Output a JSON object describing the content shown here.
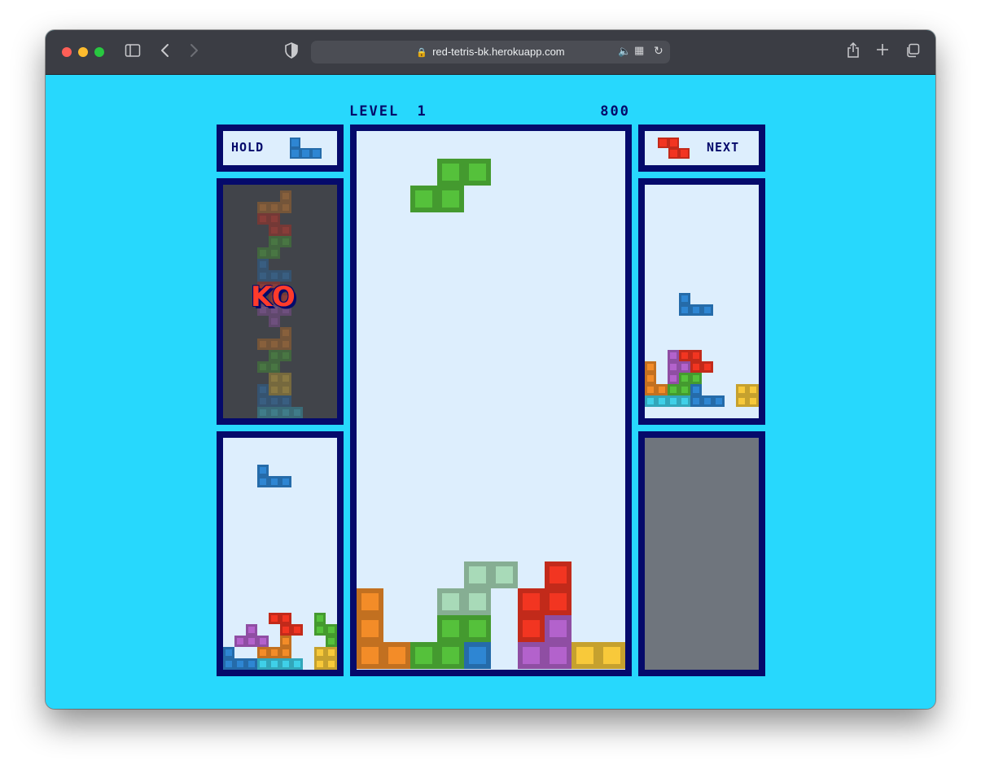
{
  "browser": {
    "url": "red-tetris-bk.herokuapp.com",
    "nav_icons": {
      "sidebar": "sidebar-icon",
      "back": "back-icon",
      "forward": "forward-icon",
      "shield": "shield-icon",
      "share": "share-icon",
      "new_tab": "plus-icon",
      "tabs": "tabs-icon"
    }
  },
  "game": {
    "level_label": "LEVEL",
    "level_value": "1",
    "score": "800",
    "hold_label": "HOLD",
    "next_label": "NEXT",
    "ko_label": "KO",
    "colors": {
      "I": "#3fd0e8",
      "O": "#f8c93a",
      "T": "#b362cc",
      "S": "#55c13b",
      "Z": "#f23521",
      "J": "#2e86d3",
      "L": "#f38c28",
      "G": "#a8dab8",
      "frame": "#050a6b",
      "board_bg": "#ddeefd",
      "page_bg": "#27d8fd"
    },
    "hold_piece": {
      "cells": [
        [
          0,
          0,
          "J"
        ],
        [
          0,
          1,
          "J"
        ],
        [
          1,
          1,
          "J"
        ],
        [
          2,
          1,
          "J"
        ]
      ]
    },
    "next_piece": {
      "cells": [
        [
          0,
          0,
          "Z"
        ],
        [
          1,
          0,
          "Z"
        ],
        [
          1,
          1,
          "Z"
        ],
        [
          2,
          1,
          "Z"
        ]
      ]
    },
    "main_board": {
      "cols": 10,
      "rows": 20,
      "cells": [
        [
          3,
          1,
          "S"
        ],
        [
          4,
          1,
          "S"
        ],
        [
          3,
          2,
          "S"
        ],
        [
          2,
          2,
          "S"
        ],
        [
          4,
          16,
          "G"
        ],
        [
          5,
          16,
          "G"
        ],
        [
          3,
          17,
          "G"
        ],
        [
          4,
          17,
          "G"
        ],
        [
          7,
          16,
          "Z"
        ],
        [
          6,
          17,
          "Z"
        ],
        [
          7,
          17,
          "Z"
        ],
        [
          6,
          18,
          "Z"
        ],
        [
          0,
          17,
          "L"
        ],
        [
          0,
          18,
          "L"
        ],
        [
          0,
          19,
          "L"
        ],
        [
          1,
          19,
          "L"
        ],
        [
          3,
          18,
          "S"
        ],
        [
          4,
          18,
          "S"
        ],
        [
          2,
          19,
          "S"
        ],
        [
          3,
          19,
          "S"
        ],
        [
          4,
          19,
          "J"
        ],
        [
          7,
          18,
          "T"
        ],
        [
          6,
          19,
          "T"
        ],
        [
          7,
          19,
          "T"
        ],
        [
          8,
          19,
          "O"
        ],
        [
          9,
          19,
          "O"
        ]
      ]
    },
    "opponents": [
      {
        "id": "left-top",
        "ko": true,
        "cols": 10,
        "rows": 20,
        "cells": [
          [
            5,
            0,
            "L"
          ],
          [
            3,
            1,
            "L"
          ],
          [
            4,
            1,
            "L"
          ],
          [
            5,
            1,
            "L"
          ],
          [
            3,
            2,
            "Z"
          ],
          [
            4,
            2,
            "Z"
          ],
          [
            4,
            3,
            "Z"
          ],
          [
            5,
            3,
            "Z"
          ],
          [
            4,
            4,
            "S"
          ],
          [
            5,
            4,
            "S"
          ],
          [
            3,
            5,
            "S"
          ],
          [
            4,
            5,
            "S"
          ],
          [
            3,
            6,
            "J"
          ],
          [
            3,
            7,
            "J"
          ],
          [
            4,
            7,
            "J"
          ],
          [
            5,
            7,
            "J"
          ],
          [
            3,
            8,
            "Z"
          ],
          [
            4,
            8,
            "Z"
          ],
          [
            4,
            9,
            "Z"
          ],
          [
            5,
            9,
            "Z"
          ],
          [
            3,
            10,
            "T"
          ],
          [
            4,
            10,
            "T"
          ],
          [
            5,
            10,
            "T"
          ],
          [
            4,
            11,
            "T"
          ],
          [
            5,
            12,
            "L"
          ],
          [
            3,
            13,
            "L"
          ],
          [
            4,
            13,
            "L"
          ],
          [
            5,
            13,
            "L"
          ],
          [
            4,
            14,
            "S"
          ],
          [
            5,
            14,
            "S"
          ],
          [
            3,
            15,
            "S"
          ],
          [
            4,
            15,
            "S"
          ],
          [
            4,
            16,
            "O"
          ],
          [
            5,
            16,
            "O"
          ],
          [
            4,
            17,
            "O"
          ],
          [
            5,
            17,
            "O"
          ],
          [
            3,
            17,
            "J"
          ],
          [
            3,
            18,
            "J"
          ],
          [
            4,
            18,
            "J"
          ],
          [
            5,
            18,
            "J"
          ],
          [
            3,
            19,
            "I"
          ],
          [
            4,
            19,
            "I"
          ],
          [
            5,
            19,
            "I"
          ],
          [
            6,
            19,
            "I"
          ]
        ]
      },
      {
        "id": "left-bottom",
        "ko": false,
        "cols": 10,
        "rows": 20,
        "cells": [
          [
            3,
            2,
            "J"
          ],
          [
            3,
            3,
            "J"
          ],
          [
            4,
            3,
            "J"
          ],
          [
            5,
            3,
            "J"
          ],
          [
            4,
            15,
            "Z"
          ],
          [
            5,
            15,
            "Z"
          ],
          [
            5,
            16,
            "Z"
          ],
          [
            6,
            16,
            "Z"
          ],
          [
            8,
            15,
            "S"
          ],
          [
            8,
            16,
            "S"
          ],
          [
            9,
            16,
            "S"
          ],
          [
            9,
            17,
            "S"
          ],
          [
            2,
            16,
            "T"
          ],
          [
            1,
            17,
            "T"
          ],
          [
            2,
            17,
            "T"
          ],
          [
            3,
            17,
            "T"
          ],
          [
            5,
            17,
            "L"
          ],
          [
            3,
            18,
            "L"
          ],
          [
            4,
            18,
            "L"
          ],
          [
            5,
            18,
            "L"
          ],
          [
            0,
            18,
            "J"
          ],
          [
            0,
            19,
            "J"
          ],
          [
            1,
            19,
            "J"
          ],
          [
            2,
            19,
            "J"
          ],
          [
            3,
            19,
            "I"
          ],
          [
            4,
            19,
            "I"
          ],
          [
            5,
            19,
            "I"
          ],
          [
            6,
            19,
            "I"
          ],
          [
            8,
            18,
            "O"
          ],
          [
            9,
            18,
            "O"
          ],
          [
            8,
            19,
            "O"
          ],
          [
            9,
            19,
            "O"
          ]
        ]
      },
      {
        "id": "right-top",
        "ko": false,
        "cols": 10,
        "rows": 20,
        "cells": [
          [
            3,
            9,
            "J"
          ],
          [
            3,
            10,
            "J"
          ],
          [
            4,
            10,
            "J"
          ],
          [
            5,
            10,
            "J"
          ],
          [
            2,
            14,
            "T"
          ],
          [
            2,
            15,
            "T"
          ],
          [
            3,
            15,
            "T"
          ],
          [
            2,
            16,
            "T"
          ],
          [
            3,
            14,
            "Z"
          ],
          [
            4,
            14,
            "Z"
          ],
          [
            4,
            15,
            "Z"
          ],
          [
            5,
            15,
            "Z"
          ],
          [
            3,
            16,
            "S"
          ],
          [
            4,
            16,
            "S"
          ],
          [
            2,
            17,
            "S"
          ],
          [
            3,
            17,
            "S"
          ],
          [
            0,
            15,
            "L"
          ],
          [
            0,
            16,
            "L"
          ],
          [
            0,
            17,
            "L"
          ],
          [
            1,
            17,
            "L"
          ],
          [
            4,
            17,
            "J"
          ],
          [
            4,
            18,
            "J"
          ],
          [
            5,
            18,
            "J"
          ],
          [
            6,
            18,
            "J"
          ],
          [
            0,
            18,
            "I"
          ],
          [
            1,
            18,
            "I"
          ],
          [
            2,
            18,
            "I"
          ],
          [
            3,
            18,
            "I"
          ],
          [
            8,
            17,
            "O"
          ],
          [
            9,
            17,
            "O"
          ],
          [
            8,
            18,
            "O"
          ],
          [
            9,
            18,
            "O"
          ]
        ]
      },
      {
        "id": "right-bottom",
        "ko": false,
        "empty": true,
        "cols": 10,
        "rows": 20,
        "cells": []
      }
    ]
  }
}
